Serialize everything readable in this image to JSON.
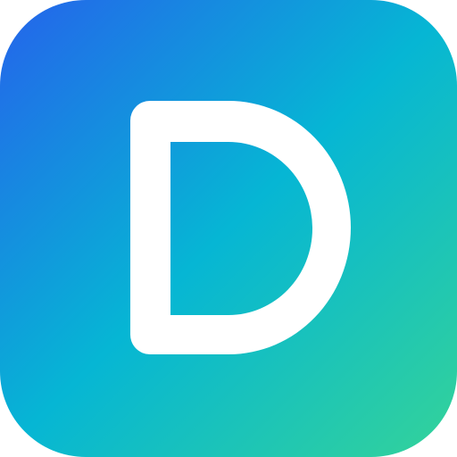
{
  "icon": {
    "name": "letter-d-app-icon",
    "letter": "D",
    "colors": {
      "gradient_start": "#2563EB",
      "gradient_mid": "#06B6D4",
      "gradient_end": "#34D399",
      "glyph": "#FFFFFF"
    }
  }
}
